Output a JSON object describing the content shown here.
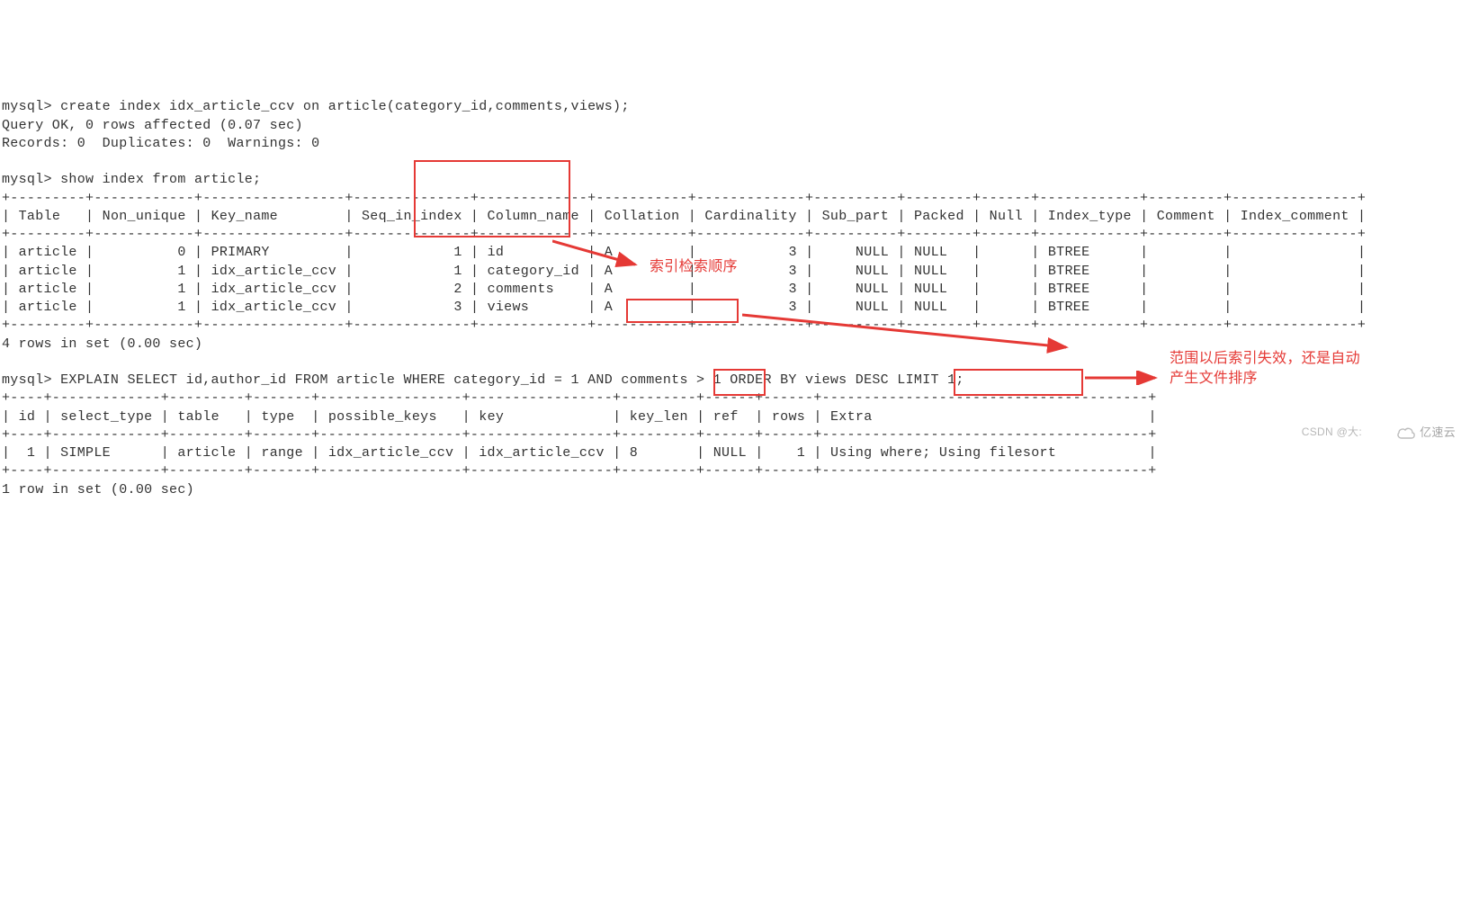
{
  "intro": {
    "cmd1_prompt": "mysql> ",
    "cmd1": "create index idx_article_ccv on article(category_id,comments,views);",
    "res1a": "Query OK, 0 rows affected (0.07 sec)",
    "res1b": "Records: 0  Duplicates: 0  Warnings: 0",
    "cmd2_prompt": "mysql> ",
    "cmd2": "show index from article;"
  },
  "index_table": {
    "headers": [
      "Table",
      "Non_unique",
      "Key_name",
      "Seq_in_index",
      "Column_name",
      "Collation",
      "Cardinality",
      "Sub_part",
      "Packed",
      "Null",
      "Index_type",
      "Comment",
      "Index_comment"
    ],
    "rows": [
      {
        "Table": "article",
        "Non_unique": "0",
        "Key_name": "PRIMARY",
        "Seq_in_index": "1",
        "Column_name": "id",
        "Collation": "A",
        "Cardinality": "3",
        "Sub_part": "NULL",
        "Packed": "NULL",
        "Null": "",
        "Index_type": "BTREE",
        "Comment": "",
        "Index_comment": ""
      },
      {
        "Table": "article",
        "Non_unique": "1",
        "Key_name": "idx_article_ccv",
        "Seq_in_index": "1",
        "Column_name": "category_id",
        "Collation": "A",
        "Cardinality": "3",
        "Sub_part": "NULL",
        "Packed": "NULL",
        "Null": "",
        "Index_type": "BTREE",
        "Comment": "",
        "Index_comment": ""
      },
      {
        "Table": "article",
        "Non_unique": "1",
        "Key_name": "idx_article_ccv",
        "Seq_in_index": "2",
        "Column_name": "comments",
        "Collation": "A",
        "Cardinality": "3",
        "Sub_part": "NULL",
        "Packed": "NULL",
        "Null": "",
        "Index_type": "BTREE",
        "Comment": "",
        "Index_comment": ""
      },
      {
        "Table": "article",
        "Non_unique": "1",
        "Key_name": "idx_article_ccv",
        "Seq_in_index": "3",
        "Column_name": "views",
        "Collation": "A",
        "Cardinality": "3",
        "Sub_part": "NULL",
        "Packed": "NULL",
        "Null": "",
        "Index_type": "BTREE",
        "Comment": "",
        "Index_comment": ""
      }
    ],
    "footer": "4 rows in set (0.00 sec)"
  },
  "explain": {
    "prompt": "mysql> ",
    "sql_before": "EXPLAIN SELECT id,author_id FROM article WHERE category_id = 1 AND ",
    "sql_box": "comments > 1",
    "sql_after": " ORDER BY views DESC LIMIT 1;",
    "headers": [
      "id",
      "select_type",
      "table",
      "type",
      "possible_keys",
      "key",
      "key_len",
      "ref",
      "rows",
      "Extra"
    ],
    "row": {
      "id": "1",
      "select_type": "SIMPLE",
      "table": "article",
      "type": "range",
      "possible_keys": "idx_article_ccv",
      "key": "idx_article_ccv",
      "key_len": "8",
      "ref": "NULL",
      "rows": "1",
      "Extra_where": "Using where;",
      "Extra_filesort": "Using filesort"
    },
    "footer": "1 row in set (0.00 sec)"
  },
  "annotations": {
    "a1": "索引检索顺序",
    "a2_line1": "范围以后索引失效，还是自动",
    "a2_line2": "产生文件排序"
  },
  "watermark": {
    "csdn": "CSDN @大:",
    "yisu": "亿速云"
  }
}
